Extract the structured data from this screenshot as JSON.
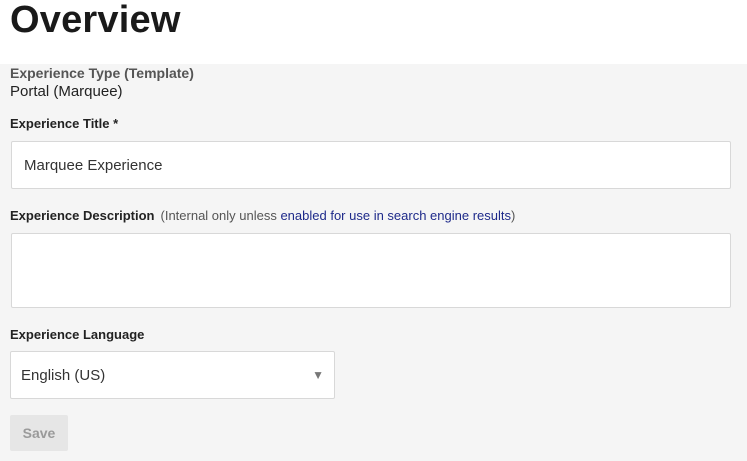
{
  "header": {
    "title": "Overview"
  },
  "experience_type": {
    "label": "Experience Type (Template)",
    "value": "Portal (Marquee)"
  },
  "experience_title": {
    "label": "Experience Title *",
    "value": "Marquee Experience"
  },
  "experience_description": {
    "label": "Experience Description",
    "hint_prefix": "(Internal only unless ",
    "hint_link": "enabled for use in search engine results",
    "hint_suffix": ")",
    "value": ""
  },
  "experience_language": {
    "label": "Experience Language",
    "selected": "English (US)",
    "chevron_icon": "chevron-down-icon"
  },
  "actions": {
    "save_label": "Save"
  }
}
